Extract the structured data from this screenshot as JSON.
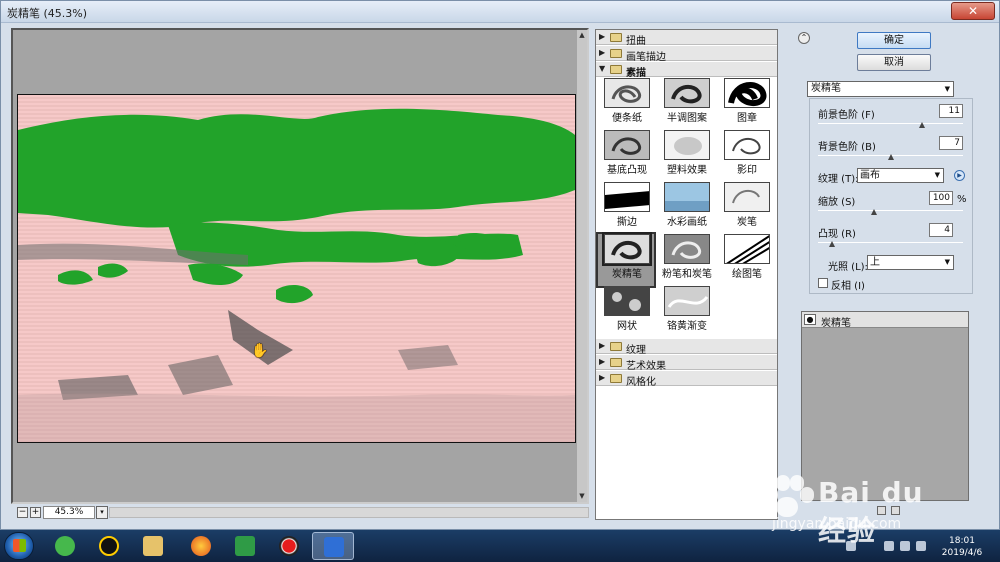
{
  "window": {
    "title": "炭精笔 (45.3%)",
    "close_glyph": "✕"
  },
  "preview": {
    "zoom": "45.3%",
    "zoom_minus": "−",
    "zoom_plus": "+",
    "dropdown_glyph": "▾",
    "cursor_glyph": "✋"
  },
  "gallery": {
    "categories_top": [
      {
        "label": "扭曲"
      },
      {
        "label": "画笔描边"
      },
      {
        "label": "素描",
        "open": true
      }
    ],
    "thumbnails": [
      "便条纸",
      "半调图案",
      "图章",
      "基底凸现",
      "塑料效果",
      "影印",
      "撕边",
      "水彩画纸",
      "炭笔",
      "炭精笔",
      "粉笔和炭笔",
      "绘图笔",
      "网状",
      "铬黄渐变"
    ],
    "selected": "炭精笔",
    "categories_bottom": [
      {
        "label": "纹理"
      },
      {
        "label": "艺术效果"
      },
      {
        "label": "风格化"
      }
    ]
  },
  "buttons": {
    "ok": "确定",
    "cancel": "取消",
    "collapse_glyph": "⌃"
  },
  "settings": {
    "filter": "炭精笔",
    "foreground_label": "前景色阶 (F)",
    "foreground_value": "11",
    "background_label": "背景色阶 (B)",
    "background_value": "7",
    "texture_label": "纹理 (T):",
    "texture_value": "画布",
    "scale_label": "缩放 (S)",
    "scale_value": "100",
    "scale_unit": "%",
    "relief_label": "凸现 (R)",
    "relief_value": "4",
    "light_label": "光照 (L):",
    "light_value": "上",
    "invert_label": "反相 (I)",
    "levels": {
      "foreground": 0.73,
      "background": 0.5,
      "scale": 0.38,
      "relief": 0.08
    }
  },
  "layers": {
    "items": [
      {
        "label": "炭精笔"
      }
    ]
  },
  "taskbar": {
    "time": "18:01",
    "date": "2019/4/6"
  },
  "watermark": {
    "text": "Bai du 经验",
    "url": "jingyan.baidu.com"
  },
  "colors": {
    "sketch_green": "#22a32a",
    "sketch_pink": "#f6c9c8",
    "preview_gray": "#a4a4a4"
  }
}
